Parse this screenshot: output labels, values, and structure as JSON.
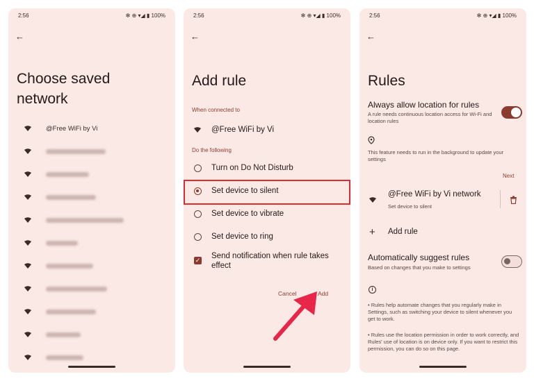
{
  "status_bar": {
    "time": "2:56",
    "icons": "✻ ⊕ ▾◢ ▮ 100%"
  },
  "panel1": {
    "title": "Choose saved network",
    "networks": [
      {
        "name": "@Free WiFi by Vi",
        "blurred": false
      },
      {
        "name": "",
        "blurred": true
      },
      {
        "name": "",
        "blurred": true
      },
      {
        "name": "",
        "blurred": true
      },
      {
        "name": "",
        "blurred": true
      },
      {
        "name": "",
        "blurred": true
      },
      {
        "name": "",
        "blurred": true
      },
      {
        "name": "",
        "blurred": true
      },
      {
        "name": "",
        "blurred": true
      },
      {
        "name": "",
        "blurred": true
      },
      {
        "name": "",
        "blurred": true
      }
    ]
  },
  "panel2": {
    "title": "Add rule",
    "when_connected_label": "When connected to",
    "network": "@Free WiFi by Vi",
    "do_following_label": "Do the following",
    "options": [
      {
        "label": "Turn on Do Not Disturb",
        "selected": false
      },
      {
        "label": "Set device to silent",
        "selected": true
      },
      {
        "label": "Set device to vibrate",
        "selected": false
      },
      {
        "label": "Set device to ring",
        "selected": false
      }
    ],
    "notify_checkbox": {
      "label": "Send notification when rule takes effect",
      "checked": true
    },
    "cancel_label": "Cancel",
    "add_label": "Add"
  },
  "panel3": {
    "title": "Rules",
    "always_allow": {
      "title": "Always allow location for rules",
      "subtitle": "A rule needs continuous location access for Wi-Fi and location rules",
      "enabled": true
    },
    "background_note": "This feature needs to run in the background to update your settings",
    "next_label": "Next",
    "rule": {
      "name": "@Free WiFi by Vi network",
      "action": "Set device to silent"
    },
    "add_rule_label": "Add rule",
    "auto_suggest": {
      "title": "Automatically suggest rules",
      "subtitle": "Based on changes that you make to settings",
      "enabled": false
    },
    "info_1": "• Rules help automate changes that you regularly make in Settings, such as switching your device to silent whenever you get to work.",
    "info_2": "• Rules use the location permission in order to work correctly, and Rules' use of location is on device only. If you want to restrict this permission, you can do so on this page."
  },
  "colors": {
    "accent": "#8c3a2f",
    "background": "#fbe9e5",
    "highlight_box": "#e02a32"
  }
}
